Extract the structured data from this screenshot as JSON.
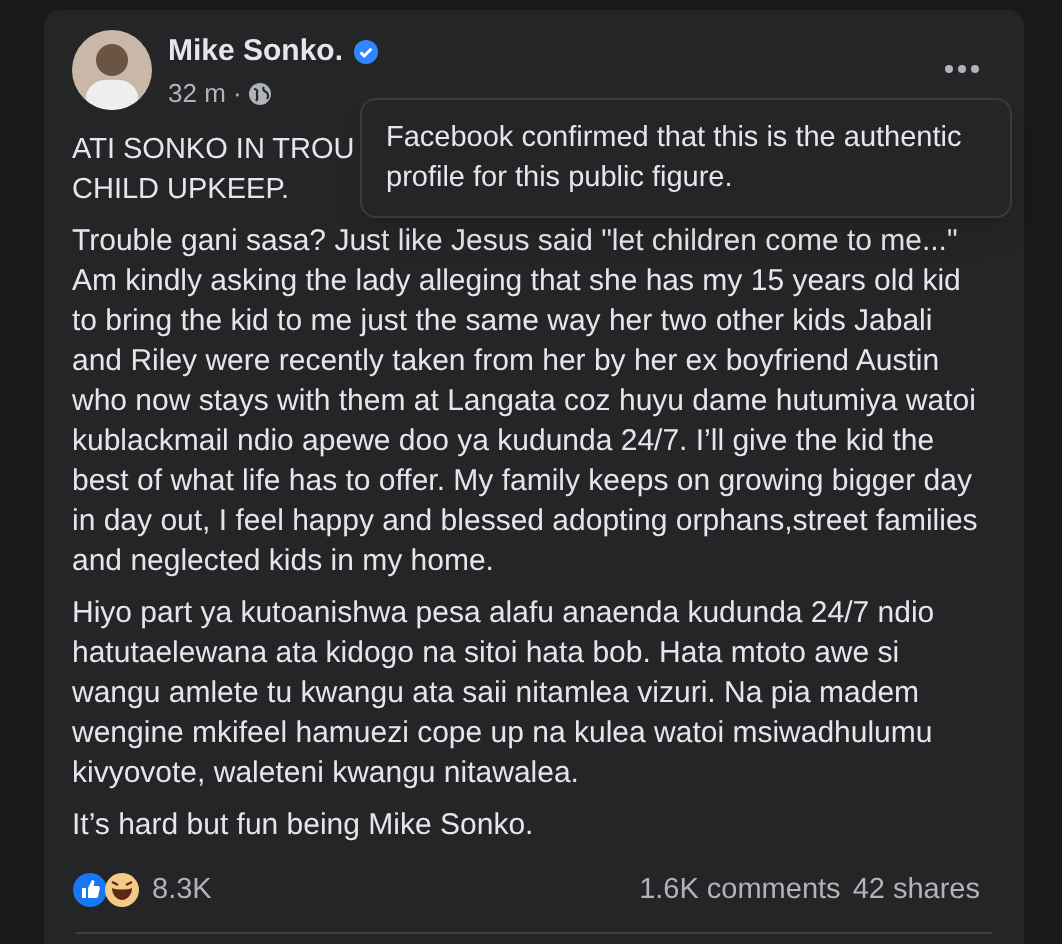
{
  "post": {
    "author": "Mike Sonko.",
    "verified": true,
    "time": "32 m ·",
    "tooltip": "Facebook confirmed that this is the authentic profile for this public figure.",
    "heading_lines": [
      "ATI SONKO IN TROU",
      "CHILD UPKEEP."
    ],
    "paragraphs": [
      "Trouble gani sasa? Just like Jesus said \"let children come to me...\" Am kindly asking the lady alleging that she has my 15 years old kid to bring the kid to me just the same way her two other kids Jabali and Riley were recently taken from her by her ex boyfriend Austin who now stays with them at Langata coz huyu dame hutumiya watoi kublackmail ndio apewe doo ya kudunda 24/7.  I’ll give the kid the best of what life has to offer. My family keeps on growing bigger day in day out, I feel happy and blessed adopting orphans,street families and neglected kids in my home.",
      "Hiyo part ya kutoanishwa pesa alafu anaenda kudunda 24/7 ndio hatutaelewana ata kidogo na sitoi hata bob. Hata mtoto awe si wangu amlete tu kwangu ata saii nitamlea vizuri. Na pia madem wengine mkifeel hamuezi cope up na kulea watoi msiwadhulumu kivyovote, waleteni kwangu nitawalea.",
      "It’s hard but fun being Mike Sonko."
    ],
    "reactions": {
      "count": "8.3K",
      "comments": "1.6K comments",
      "shares": "42 shares"
    }
  }
}
